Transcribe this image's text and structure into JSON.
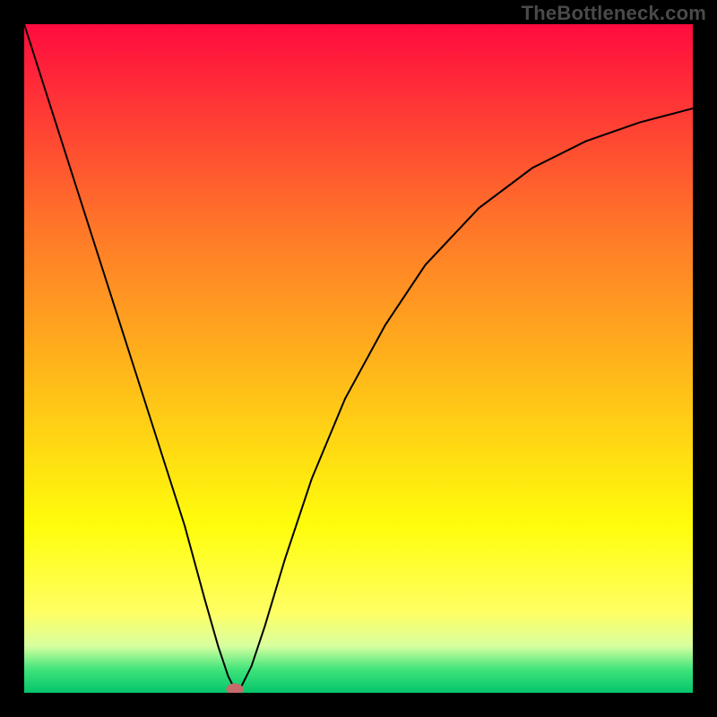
{
  "watermark": "TheBottleneck.com",
  "chart_data": {
    "type": "line",
    "title": "",
    "xlabel": "",
    "ylabel": "",
    "xlim": [
      0,
      100
    ],
    "ylim": [
      0,
      100
    ],
    "grid": false,
    "background_gradient": {
      "stops": [
        {
          "color": "#ff0b3e",
          "pos": 0.0
        },
        {
          "color": "#ff4034",
          "pos": 0.15
        },
        {
          "color": "#ff7529",
          "pos": 0.3
        },
        {
          "color": "#ffa21f",
          "pos": 0.45
        },
        {
          "color": "#ffd015",
          "pos": 0.6
        },
        {
          "color": "#fffd0b",
          "pos": 0.75
        },
        {
          "color": "#ffff64",
          "pos": 0.88
        },
        {
          "color": "#d8ffa0",
          "pos": 0.93
        },
        {
          "color": "#3fe47a",
          "pos": 0.965
        },
        {
          "color": "#05c46b",
          "pos": 1.0
        }
      ]
    },
    "curve": {
      "x": [
        0,
        4,
        8,
        12,
        16,
        20,
        24,
        27,
        29,
        30.5,
        31.5,
        32.5,
        34,
        36,
        39,
        43,
        48,
        54,
        60,
        68,
        76,
        84,
        92,
        100
      ],
      "y": [
        100,
        87.5,
        75,
        62.5,
        50,
        37.5,
        25,
        14,
        7,
        2.5,
        0.5,
        1,
        4,
        10,
        20,
        32,
        44,
        55,
        64,
        72.5,
        78.5,
        82.5,
        85.3,
        87.4
      ]
    },
    "marker": {
      "x": 31.5,
      "y": 0.5,
      "color": "#c76a6a"
    }
  }
}
